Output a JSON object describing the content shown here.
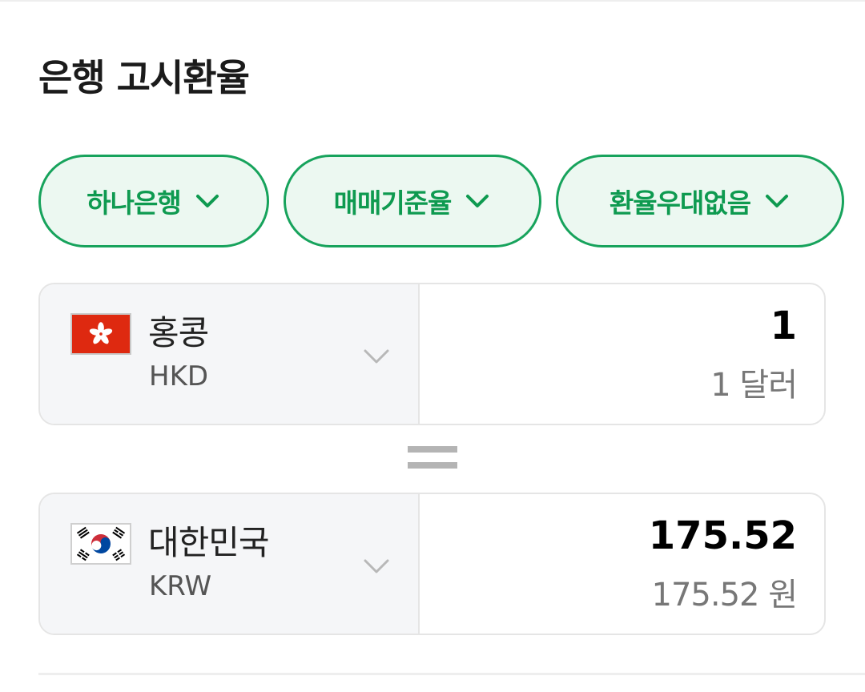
{
  "title": "은행 고시환율",
  "filters": [
    {
      "label": "하나은행",
      "icon": "chevron-down-icon"
    },
    {
      "label": "매매기준율",
      "icon": "chevron-down-icon"
    },
    {
      "label": "환율우대없음",
      "icon": "chevron-down-icon"
    }
  ],
  "from": {
    "country": "홍콩",
    "code": "HKD",
    "amount": "1",
    "amount_text": "1 달러",
    "flag_icon": "hong-kong-flag-icon"
  },
  "equals_icon": "equals-icon",
  "to": {
    "country": "대한민국",
    "code": "KRW",
    "amount": "175.52",
    "amount_text": "175.52 원",
    "flag_icon": "south-korea-flag-icon"
  },
  "colors": {
    "accent": "#17a35c",
    "chip_bg": "#ecf8f1",
    "hk_red": "#de2910",
    "kr_red": "#cd2e3a",
    "kr_blue": "#0047a0"
  }
}
